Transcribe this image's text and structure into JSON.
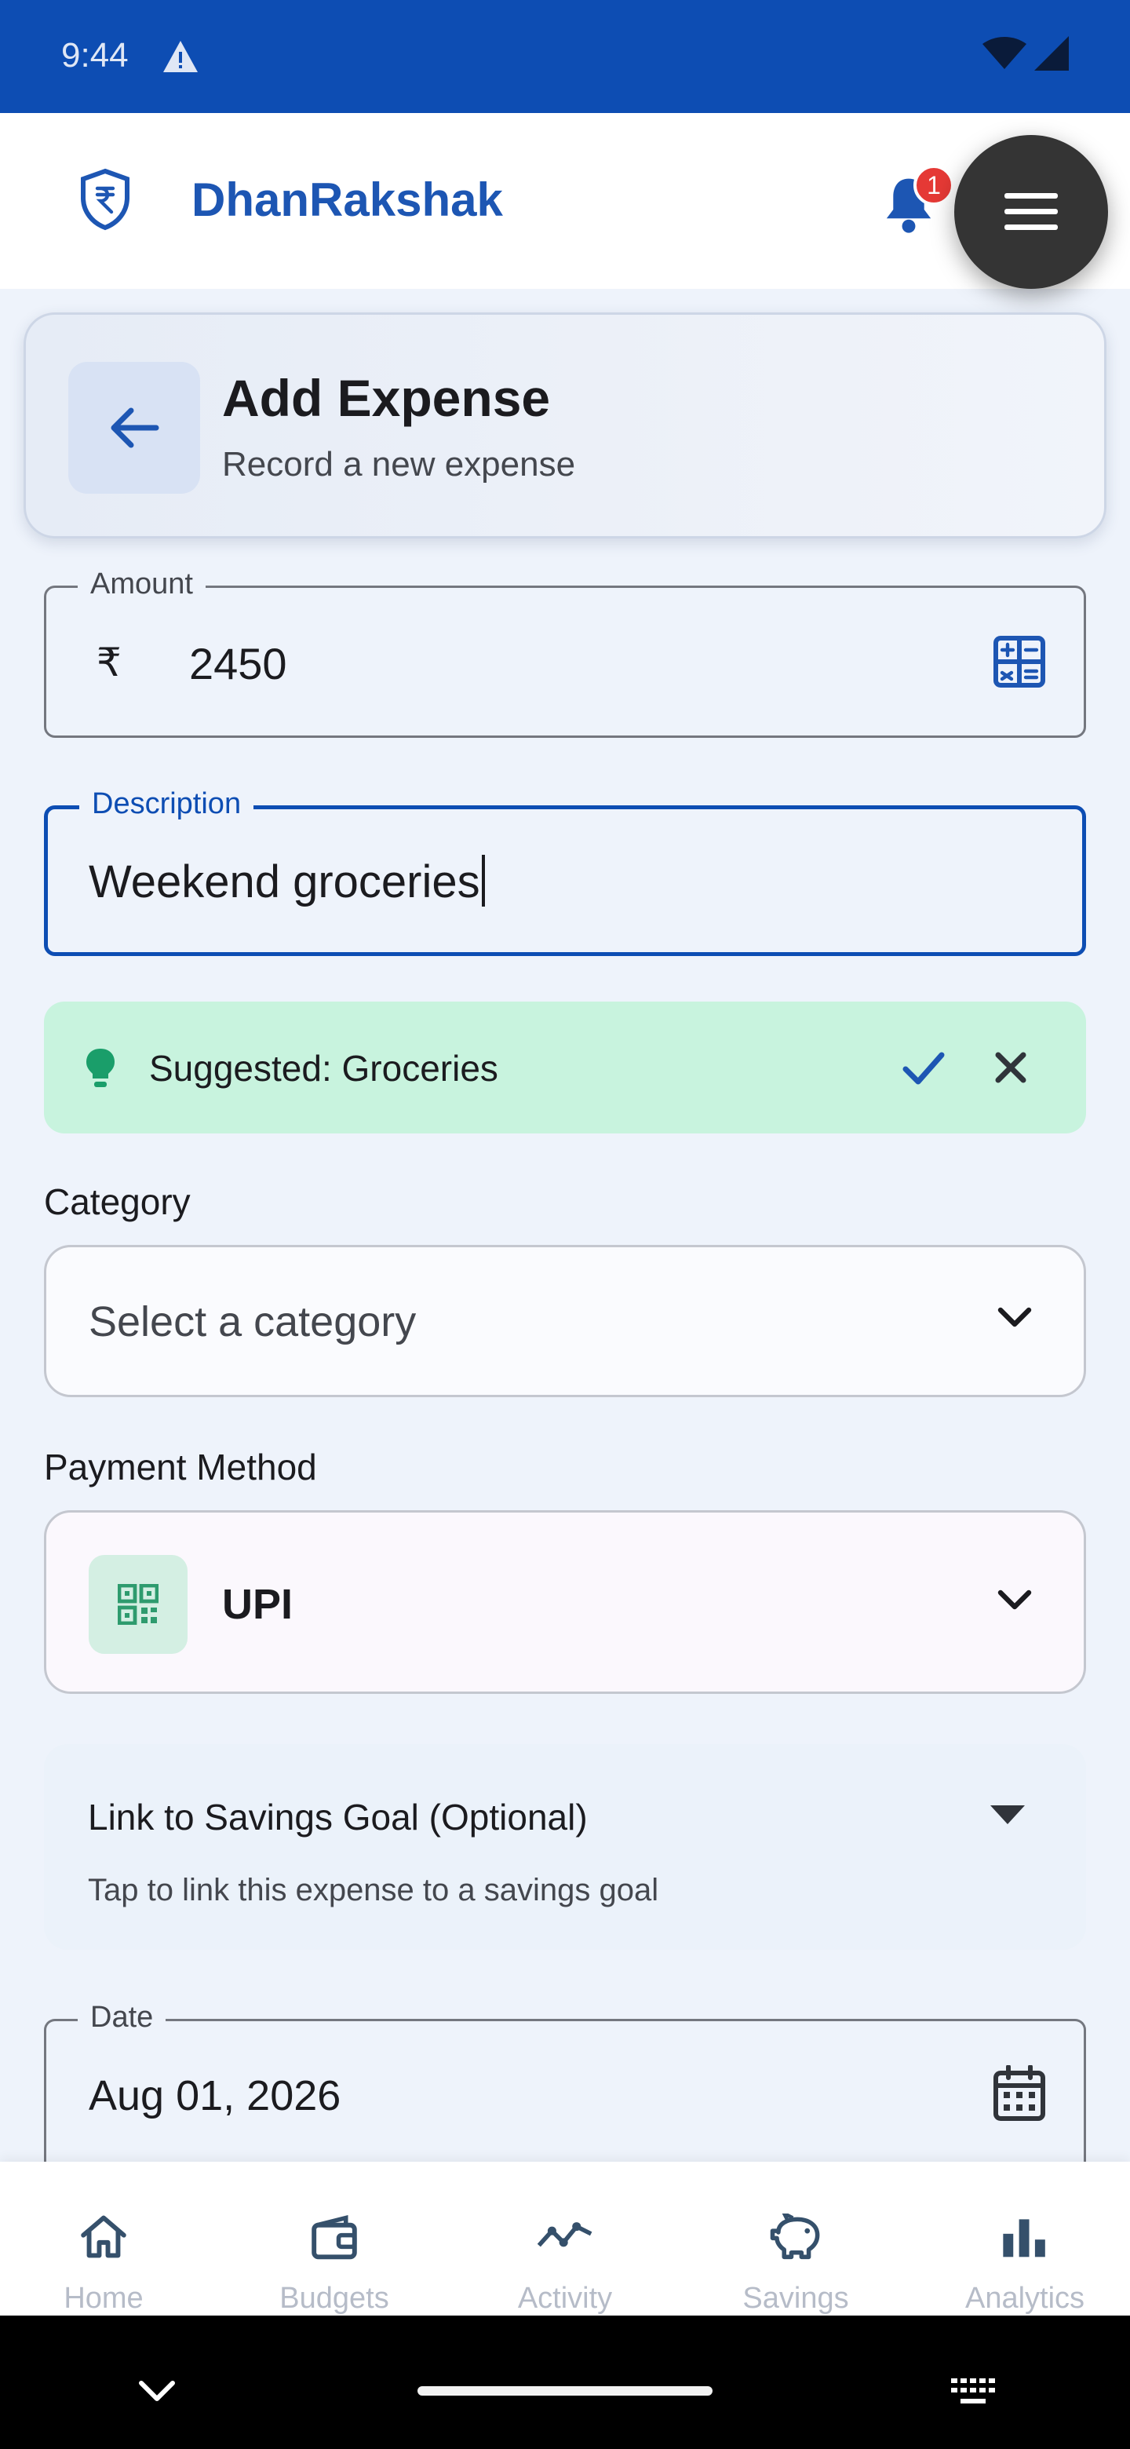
{
  "status_bar": {
    "time": "9:44"
  },
  "header": {
    "app_name": "DhanRakshak",
    "notification_count": "1"
  },
  "page": {
    "title": "Add Expense",
    "subtitle": "Record a new expense"
  },
  "form": {
    "amount": {
      "label": "Amount",
      "currency_symbol": "₹",
      "value": "2450"
    },
    "description": {
      "label": "Description",
      "value": "Weekend groceries"
    },
    "suggestion": {
      "text": "Suggested: Groceries"
    },
    "category": {
      "label": "Category",
      "placeholder": "Select a category"
    },
    "payment_method": {
      "label": "Payment Method",
      "value": "UPI"
    },
    "savings_goal": {
      "title": "Link to Savings Goal (Optional)",
      "subtitle": "Tap to link this expense to a savings goal"
    },
    "date": {
      "label": "Date",
      "value": "Aug 01, 2026"
    }
  },
  "bottom_nav": {
    "items": [
      {
        "label": "Home",
        "icon": "home-icon"
      },
      {
        "label": "Budgets",
        "icon": "wallet-icon"
      },
      {
        "label": "Activity",
        "icon": "activity-icon"
      },
      {
        "label": "Savings",
        "icon": "piggy-bank-icon"
      },
      {
        "label": "Analytics",
        "icon": "bar-chart-icon"
      }
    ]
  },
  "colors": {
    "primary": "#0d4db3",
    "status_bar": "#0d4db3",
    "suggestion_bg": "#c8f3de",
    "badge": "#e53935",
    "accent_green": "#1a9e6a"
  }
}
